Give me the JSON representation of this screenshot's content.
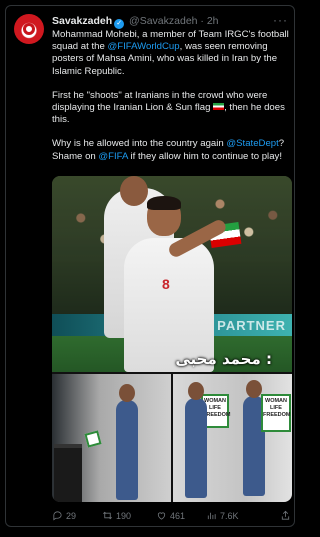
{
  "author": {
    "name": "Savakzadeh",
    "handle": "@Savakzadeh",
    "separator": "·",
    "time": "2h",
    "verified_icon": "verified-badge-icon",
    "avatar_color": "#d0181f"
  },
  "more_icon": "more-dots-icon",
  "tweet": {
    "p1_a": "Mohammad Mohebi, a member of Team IRGC's football squad at the ",
    "p1_link": "@FIFAWorldCup",
    "p1_b": ", was seen removing posters of Mahsa Amini, who was killed in Iran by the Islamic Republic.",
    "p2_a": "First he \"shoots\" at Iranians in the crowd who were displaying the Iranian Lion & Sun flag ",
    "p2_flag": "iran-flag-emoji",
    "p2_b": ", then he does this.",
    "p3_a": "Why is he allowed into the country again ",
    "p3_link1": "@StateDept",
    "p3_b": "? Shame on ",
    "p3_link2": "@FIFA",
    "p3_c": " if they allow him to continue to play!"
  },
  "media": {
    "caption": "محمد محبی :",
    "ad_text": "PARTNER",
    "jersey_number": "8",
    "poster_left": "WOMAN LIFE FREEDOM",
    "poster_right": "WOMAN LIFE FREEDOM"
  },
  "actions": {
    "reply_count": "29",
    "retweet_count": "190",
    "like_count": "461",
    "views_count": "7.6K",
    "accent": "#1d9bf0",
    "muted": "#71767b"
  }
}
